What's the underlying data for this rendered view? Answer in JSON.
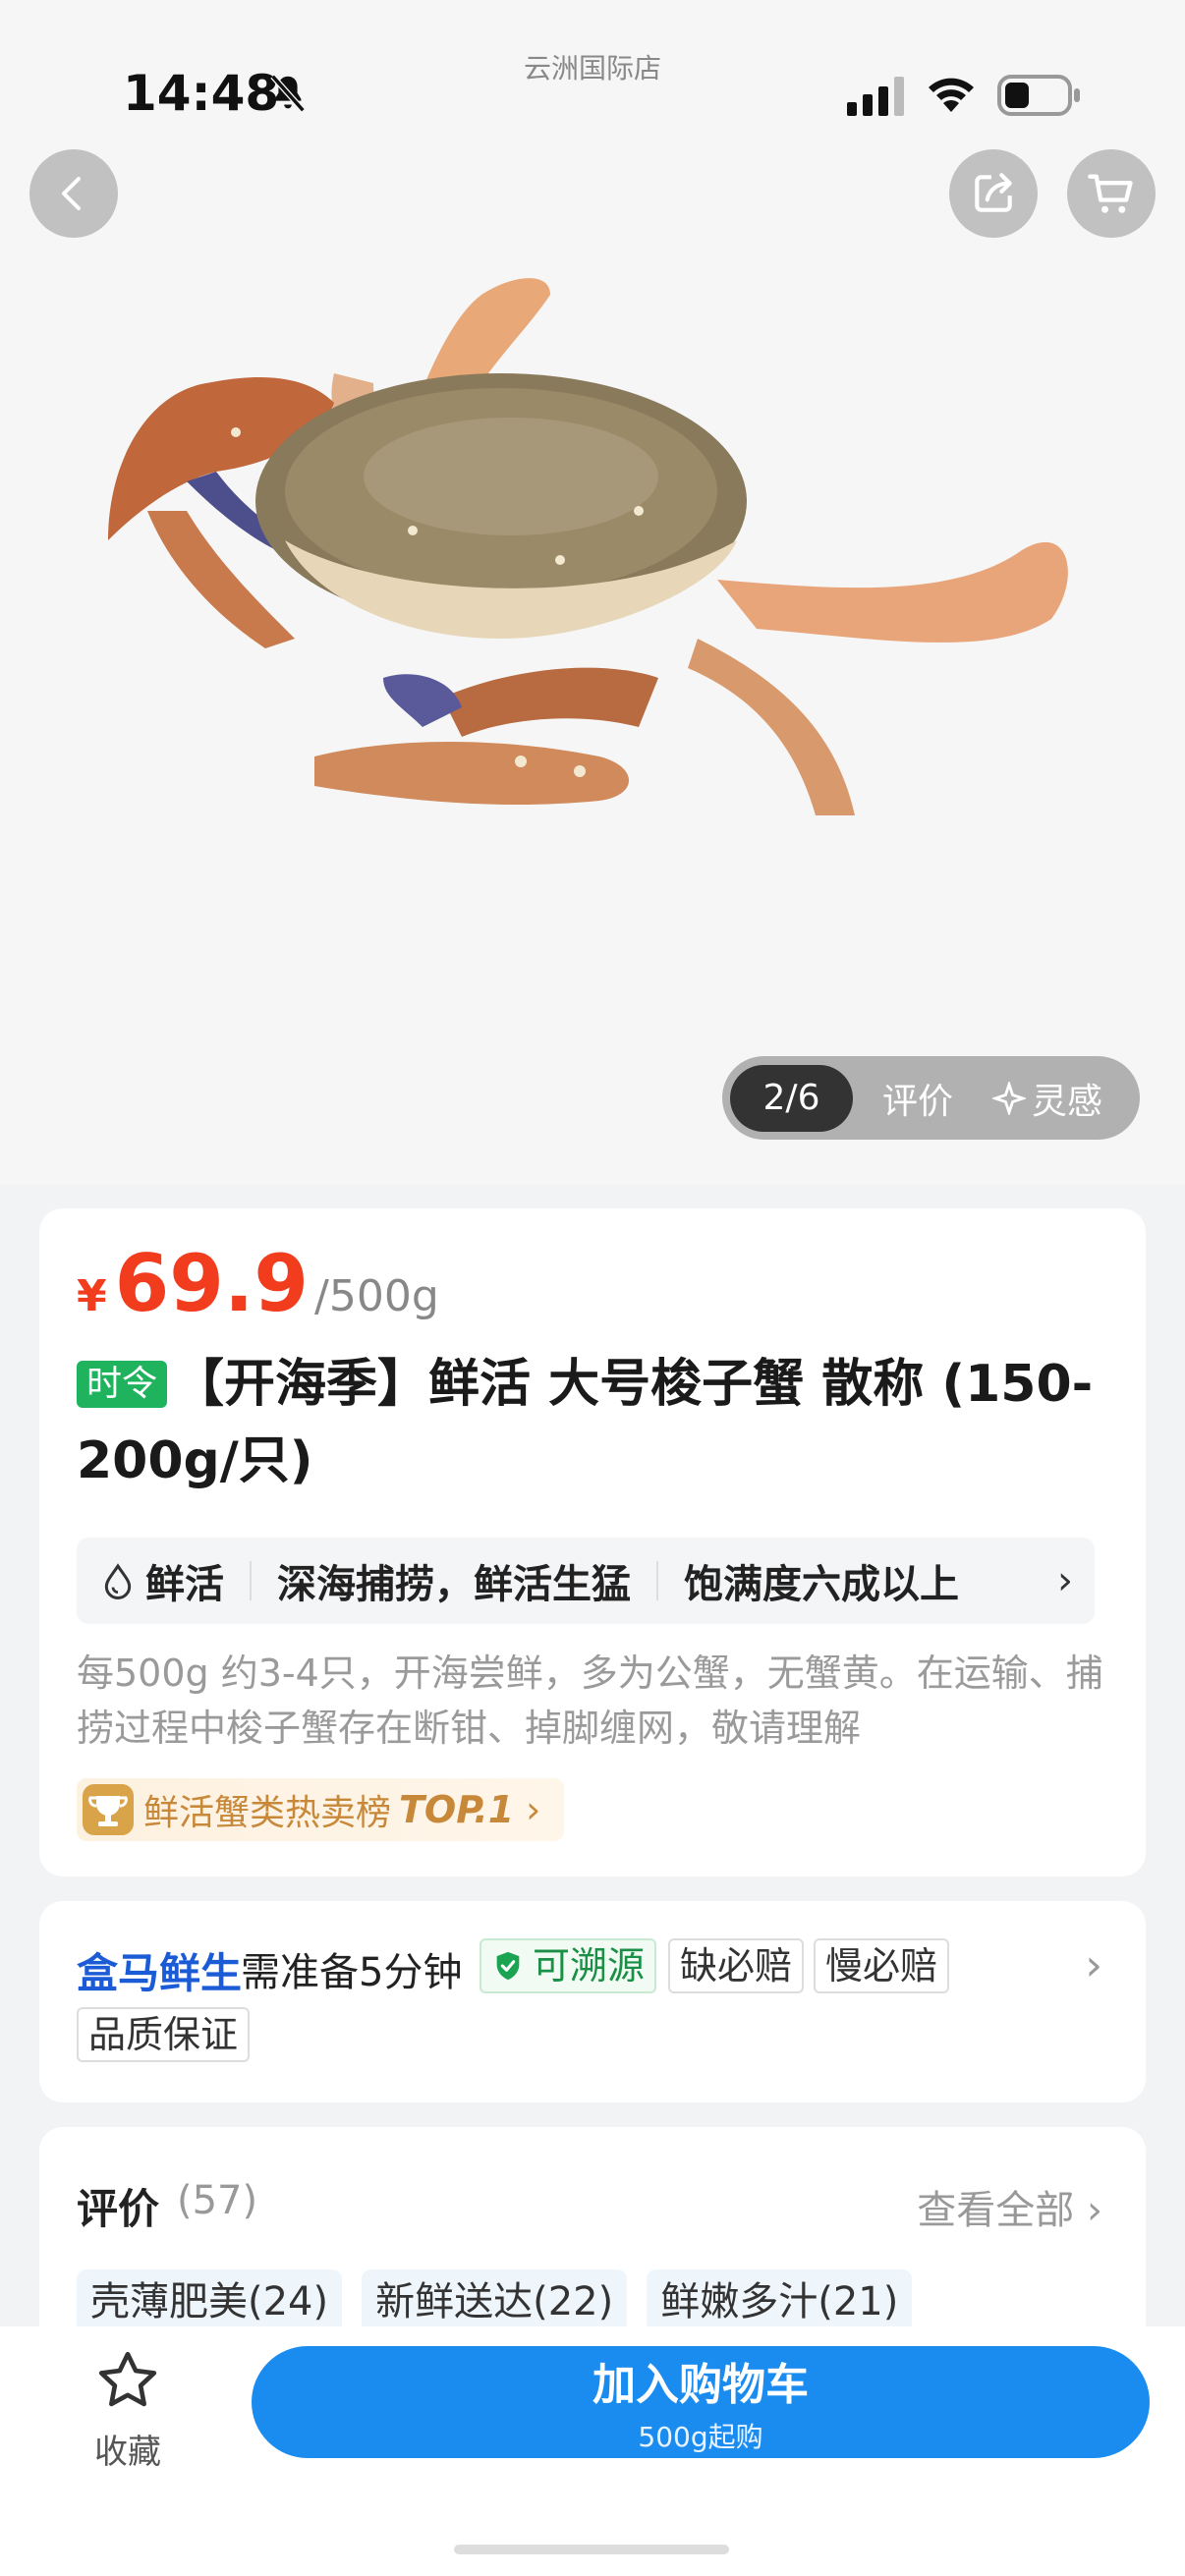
{
  "status_bar": {
    "time": "14:48",
    "store_name": "云洲国际店"
  },
  "gallery": {
    "counter": "2/6",
    "review_tab": "评价",
    "ai_tab": "灵感"
  },
  "product": {
    "price_symbol": "¥",
    "price": "69.9",
    "unit": "/500g",
    "seasonal_tag": "时令",
    "title": "【开海季】鲜活 大号梭子蟹 散称 (150-200g/只)",
    "attributes": [
      "鲜活",
      "深海捕捞，鲜活生猛",
      "饱满度六成以上"
    ],
    "description": "每500g 约3-4只，开海尝鲜，多为公蟹，无蟹黄。在运输、捕捞过程中梭子蟹存在断钳、掉脚缠网，敬请理解",
    "rank_text": "鲜活蟹类热卖榜",
    "rank_top": "TOP.1"
  },
  "delivery": {
    "brand": "盒马鲜生",
    "note": "需准备5分钟",
    "badges": [
      "可溯源",
      "缺必赔",
      "慢必赔",
      "品质保证"
    ]
  },
  "reviews": {
    "title": "评价",
    "count": "(57)",
    "view_all": "查看全部",
    "tags": [
      "壳薄肥美(24)",
      "新鲜送达(22)",
      "鲜嫩多汁(21)"
    ]
  },
  "bottom_bar": {
    "favorite_label": "收藏",
    "add_cart_label": "加入购物车",
    "add_cart_sub": "500g起购"
  },
  "colors": {
    "price": "#f23c1e",
    "primary": "#1a8cf0",
    "brand": "#1b5bd6",
    "seasonal": "#1fb35d"
  }
}
